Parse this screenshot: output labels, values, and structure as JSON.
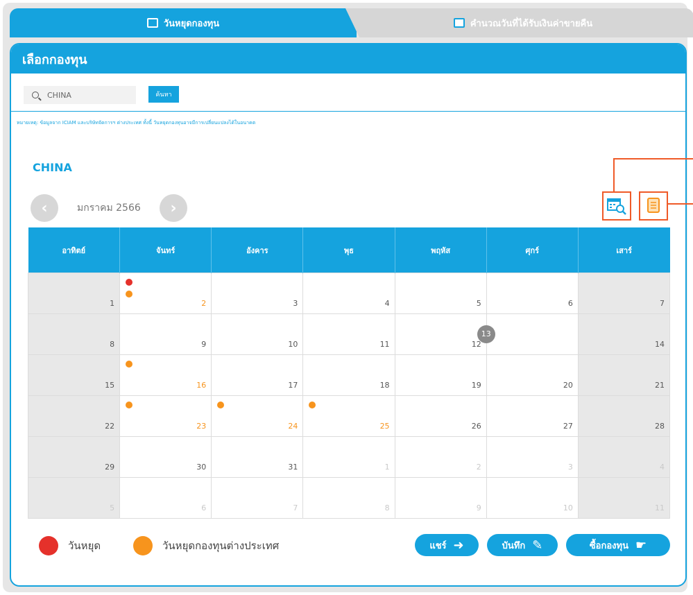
{
  "tabs": [
    {
      "label": "วันหยุดกองทุน",
      "icon": "calendar-icon"
    },
    {
      "label": "คำนวณวันที่ได้รับเงินค่าขายคืน",
      "icon": "calendar-check-icon"
    }
  ],
  "panel": {
    "title": "เลือกกองทุน",
    "search": {
      "value": "CHINA",
      "button_label": "ค้นหา"
    },
    "note": "หมายเหตุ: ข้อมูลจาก ICIAM และบริษัทจัดการฯ ต่างประเทศ ทั้งนี้ วันหยุดกองทุนอาจมีการเปลี่ยนแปลงได้ในอนาคต"
  },
  "fund_name": "CHINA",
  "month_label": "มกราคม 2566",
  "nav": {
    "prev": "‹",
    "next": "›"
  },
  "colors": {
    "accent": "#15a3de",
    "holiday": "#e5312b",
    "foreign_holiday": "#f7941d",
    "highlight": "#ef5a28"
  },
  "weekdays": [
    "อาทิตย์",
    "จันทร์",
    "อังคาร",
    "พุธ",
    "พฤหัส",
    "ศุกร์",
    "เสาร์"
  ],
  "weeks": [
    [
      {
        "d": "1"
      },
      {
        "d": "2",
        "red": true,
        "orange": true
      },
      {
        "d": "3"
      },
      {
        "d": "4"
      },
      {
        "d": "5"
      },
      {
        "d": "6"
      },
      {
        "d": "7"
      }
    ],
    [
      {
        "d": "8"
      },
      {
        "d": "9"
      },
      {
        "d": "10"
      },
      {
        "d": "11"
      },
      {
        "d": "12"
      },
      {
        "d": "13",
        "today": true
      },
      {
        "d": "14"
      }
    ],
    [
      {
        "d": "15"
      },
      {
        "d": "16",
        "orange": true
      },
      {
        "d": "17"
      },
      {
        "d": "18"
      },
      {
        "d": "19"
      },
      {
        "d": "20"
      },
      {
        "d": "21"
      }
    ],
    [
      {
        "d": "22"
      },
      {
        "d": "23",
        "orange": true
      },
      {
        "d": "24",
        "orange": true
      },
      {
        "d": "25",
        "orange": true
      },
      {
        "d": "26"
      },
      {
        "d": "27"
      },
      {
        "d": "28"
      }
    ],
    [
      {
        "d": "29"
      },
      {
        "d": "30"
      },
      {
        "d": "31"
      },
      {
        "d": "1",
        "faded": true
      },
      {
        "d": "2",
        "faded": true
      },
      {
        "d": "3",
        "faded": true
      },
      {
        "d": "4",
        "faded": true
      }
    ],
    [
      {
        "d": "5",
        "faded": true
      },
      {
        "d": "6",
        "faded": true
      },
      {
        "d": "7",
        "faded": true
      },
      {
        "d": "8",
        "faded": true
      },
      {
        "d": "9",
        "faded": true
      },
      {
        "d": "10",
        "faded": true
      },
      {
        "d": "11",
        "faded": true
      }
    ]
  ],
  "legend": {
    "holiday": "วันหยุด",
    "foreign_holiday": "วันหยุดกองทุนต่างประเทศ"
  },
  "actions": {
    "share": "แชร์",
    "save": "บันทึก",
    "buy": "ซื้อกองทุน"
  }
}
